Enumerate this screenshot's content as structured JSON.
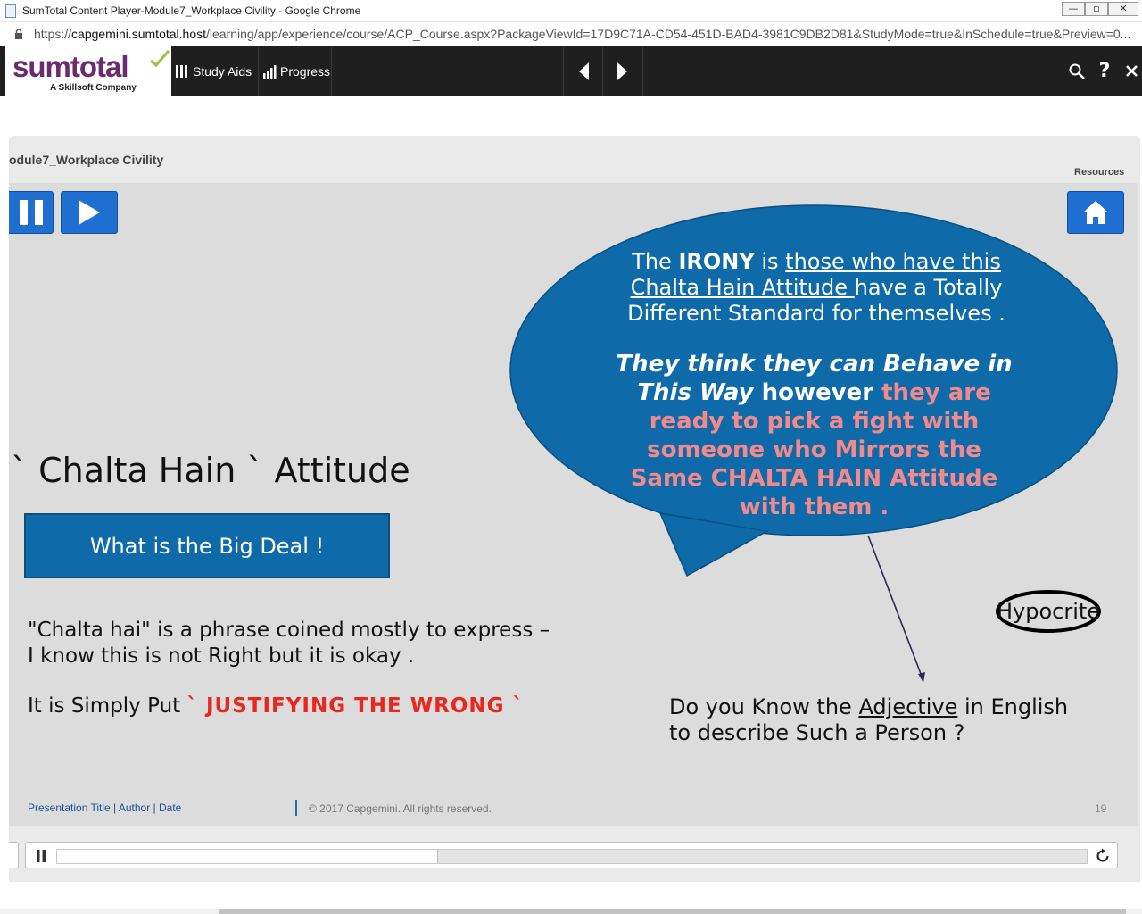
{
  "window": {
    "title": "SumTotal Content Player-Module7_Workplace Civility - Google Chrome"
  },
  "address": {
    "scheme": "https://",
    "host": "capgemini.sumtotal.host",
    "path": "/learning/app/experience/course/ACP_Course.aspx?PackageViewId=17D9C71A-CD54-451D-BAD4-3981C9DB2D81&StudyMode=true&InSchedule=true&Preview=0..."
  },
  "toolbar": {
    "logo_text": "sumtotal",
    "logo_tagline": "A Skillsoft Company",
    "study_aids_label": "Study Aids",
    "progress_label": "Progress"
  },
  "player": {
    "module_title": "odule7_Workplace Civility",
    "resources_label": "Resources"
  },
  "slide": {
    "heading": "` Chalta Hain ` Attitude",
    "big_deal_button": "What is the Big Deal !",
    "para1_line1": "\"Chalta hai\" is a phrase coined mostly to express –",
    "para1_line2": "I know this is not Right but it is okay .",
    "para2_prefix": "It is Simply Put ",
    "para2_emphasis": "` JUSTIFYING THE  WRONG `",
    "bubble": {
      "l1_a": "The ",
      "l1_b": "IRONY",
      "l1_c": " is ",
      "l1_d": "those who have this",
      "l2_a": "Chalta Hain Attitude ",
      "l2_b": "have a Totally",
      "l3": "Different Standard for themselves .",
      "l4": "They think they can Behave in",
      "l5_a": "This Way",
      "l5_b": " however ",
      "l5_c": " they are",
      "l6": "ready to pick a fight with",
      "l7": "someone who Mirrors the",
      "l8": "Same CHALTA HAIN Attitude",
      "l9": "with them ."
    },
    "answer_word": "Hypocrite",
    "question_a": "Do you Know the ",
    "question_b": "Adjective",
    "question_c": " in English",
    "question_line2": "to describe Such a Person ?",
    "footer_left": "Presentation Title | Author | Date",
    "footer_copy": "© 2017 Capgemini. All rights reserved.",
    "page_number": "19"
  },
  "playback": {
    "progress": 0.37
  },
  "colors": {
    "bubble": "#0e6aa8",
    "accent_red": "#e8281f",
    "accent_pink": "#f18a8c",
    "button_blue": "#1f6fd1"
  }
}
